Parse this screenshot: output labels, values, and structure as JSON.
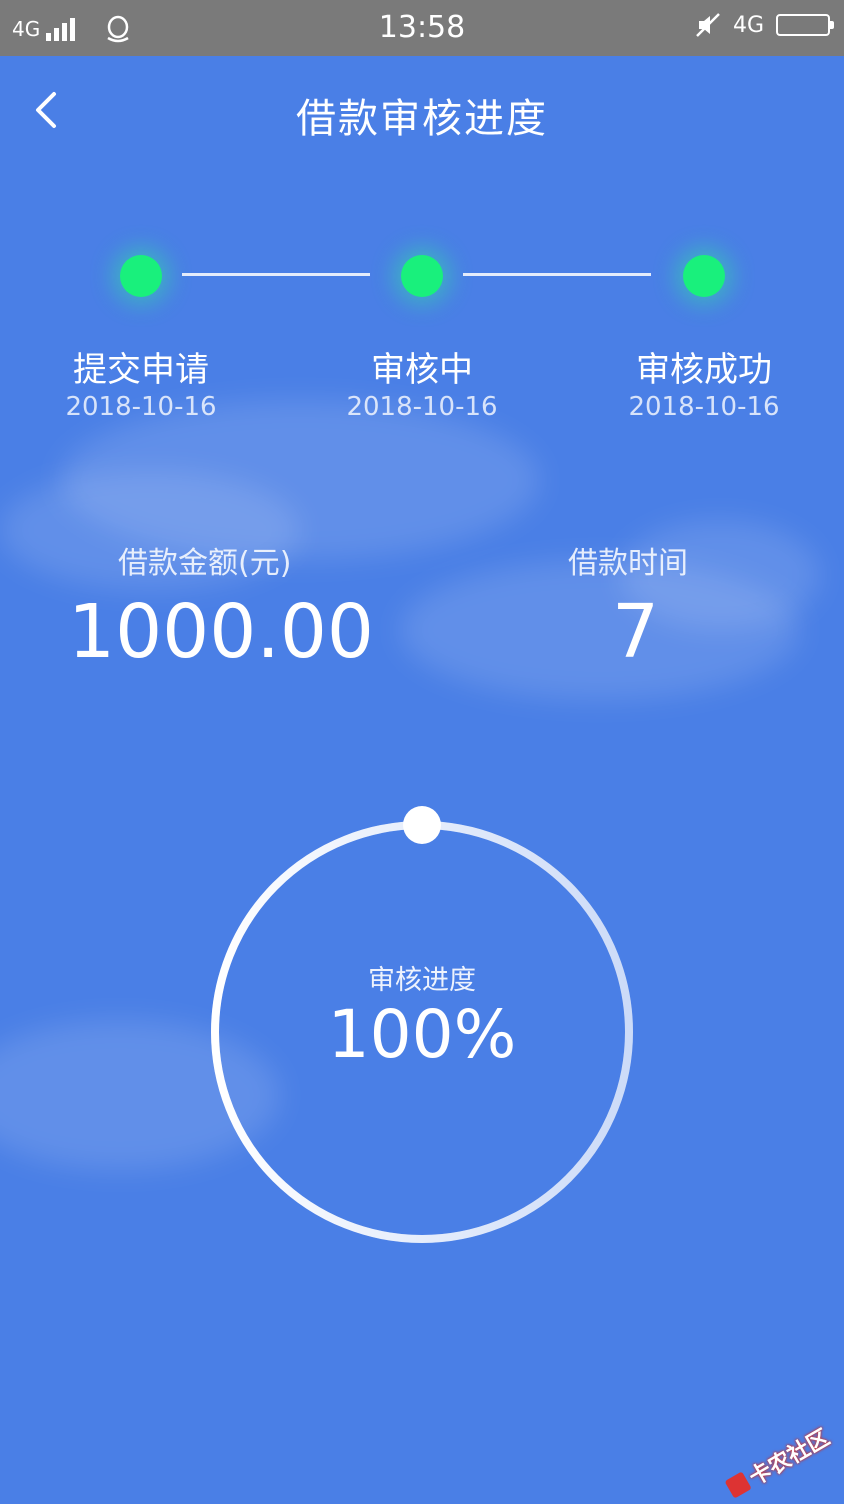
{
  "status_bar": {
    "network": "4G",
    "time": "13:58",
    "network_right": "4G"
  },
  "header": {
    "title": "借款审核进度"
  },
  "steps": [
    {
      "label": "提交申请",
      "date": "2018-10-16"
    },
    {
      "label": "审核中",
      "date": "2018-10-16"
    },
    {
      "label": "审核成功",
      "date": "2018-10-16"
    }
  ],
  "loan": {
    "amount_label": "借款金额(元)",
    "amount_value": "1000.00",
    "term_label": "借款时间",
    "term_value": "7"
  },
  "progress": {
    "label": "审核进度",
    "value_text": "100%",
    "fraction": 1.0
  },
  "watermark": {
    "text": "卡农社区"
  },
  "colors": {
    "background": "#4a7fe6",
    "step_dot": "#19f07c",
    "status_bar": "#7a7a7a"
  }
}
